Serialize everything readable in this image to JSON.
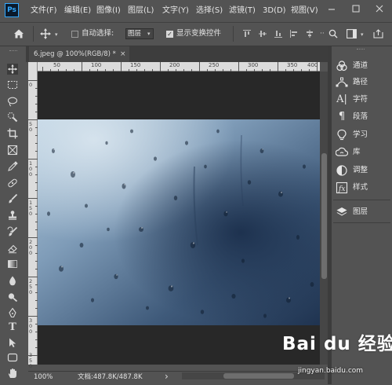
{
  "app": {
    "logo": "Ps"
  },
  "menu": {
    "items": [
      "文件(F)",
      "编辑(E)",
      "图像(I)",
      "图层(L)",
      "文字(Y)",
      "选择(S)",
      "滤镜(T)",
      "3D(D)",
      "视图(V)"
    ]
  },
  "options": {
    "auto_select_label": "自动选择:",
    "layer_select_value": "图层",
    "show_transform_label": "显示变换控件"
  },
  "document": {
    "tab_title": "6.jpeg @ 100%(RGB/8) *",
    "tab_close": "×",
    "ruler_h": [
      "50",
      "100",
      "150",
      "200",
      "250",
      "300",
      "350",
      "400"
    ],
    "ruler_v": [
      "0",
      "50",
      "100",
      "150",
      "200",
      "250",
      "300",
      "350"
    ]
  },
  "status": {
    "zoom": "100%",
    "doc_info": "文档:487.8K/487.8K",
    "arrow": "›"
  },
  "panels": [
    {
      "label": "通道",
      "icon": "channels-icon"
    },
    {
      "label": "路径",
      "icon": "paths-icon"
    },
    {
      "label": "字符",
      "icon": "character-icon"
    },
    {
      "label": "段落",
      "icon": "paragraph-icon"
    },
    {
      "label": "学习",
      "icon": "learn-icon"
    },
    {
      "label": "库",
      "icon": "libraries-icon"
    },
    {
      "label": "调整",
      "icon": "adjustments-icon"
    },
    {
      "label": "样式",
      "icon": "styles-icon"
    },
    {
      "label": "图层",
      "icon": "layers-icon"
    }
  ],
  "watermark": {
    "logo_text": "Bai du 经验",
    "url": "jingyan.baidu.com"
  },
  "colors": {
    "ui_bg": "#535353",
    "pasteboard": "#282828",
    "accent": "#31a8ff"
  }
}
